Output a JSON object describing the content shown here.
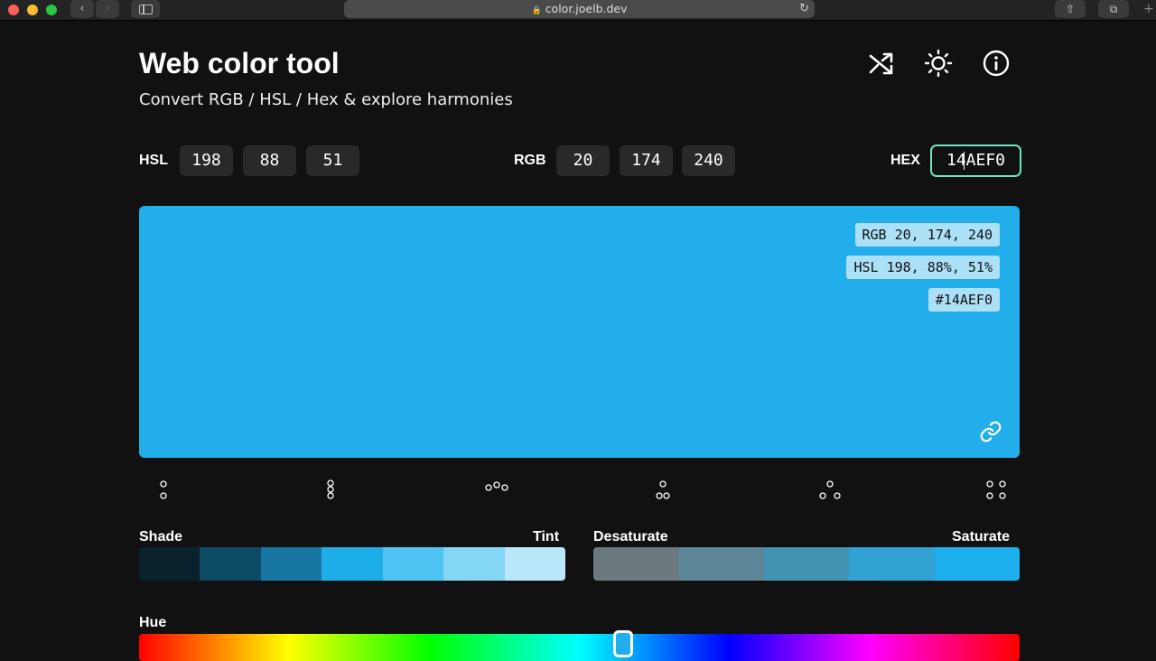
{
  "browser": {
    "url": "color.joelb.dev"
  },
  "header": {
    "title": "Web color tool",
    "subtitle": "Convert RGB / HSL / Hex & explore harmonies"
  },
  "inputs": {
    "hsl_label": "HSL",
    "hsl": [
      "198",
      "88",
      "51"
    ],
    "rgb_label": "RGB",
    "rgb": [
      "20",
      "174",
      "240"
    ],
    "hex_label": "HEX",
    "hex": "14AEF0"
  },
  "swatch": {
    "color": "#22aeea",
    "rgb_text": "RGB 20, 174, 240",
    "hsl_text": "HSL 198, 88%, 51%",
    "hex_text": "#14AEF0"
  },
  "harmonies": [
    "complementary",
    "split-complementary",
    "analogous",
    "triadic",
    "triadic-alt",
    "tetradic"
  ],
  "shade_tint": {
    "left_label": "Shade",
    "right_label": "Tint",
    "colors": [
      "#08222e",
      "#0d4a64",
      "#1777a2",
      "#1dade9",
      "#4fc4f2",
      "#84d6f6",
      "#b9e8fb"
    ]
  },
  "saturation": {
    "left_label": "Desaturate",
    "right_label": "Saturate",
    "colors": [
      "#6c7a80",
      "#5c8598",
      "#4391b3",
      "#30a3d2",
      "#1dafee"
    ]
  },
  "hue": {
    "label": "Hue",
    "value": 198
  }
}
